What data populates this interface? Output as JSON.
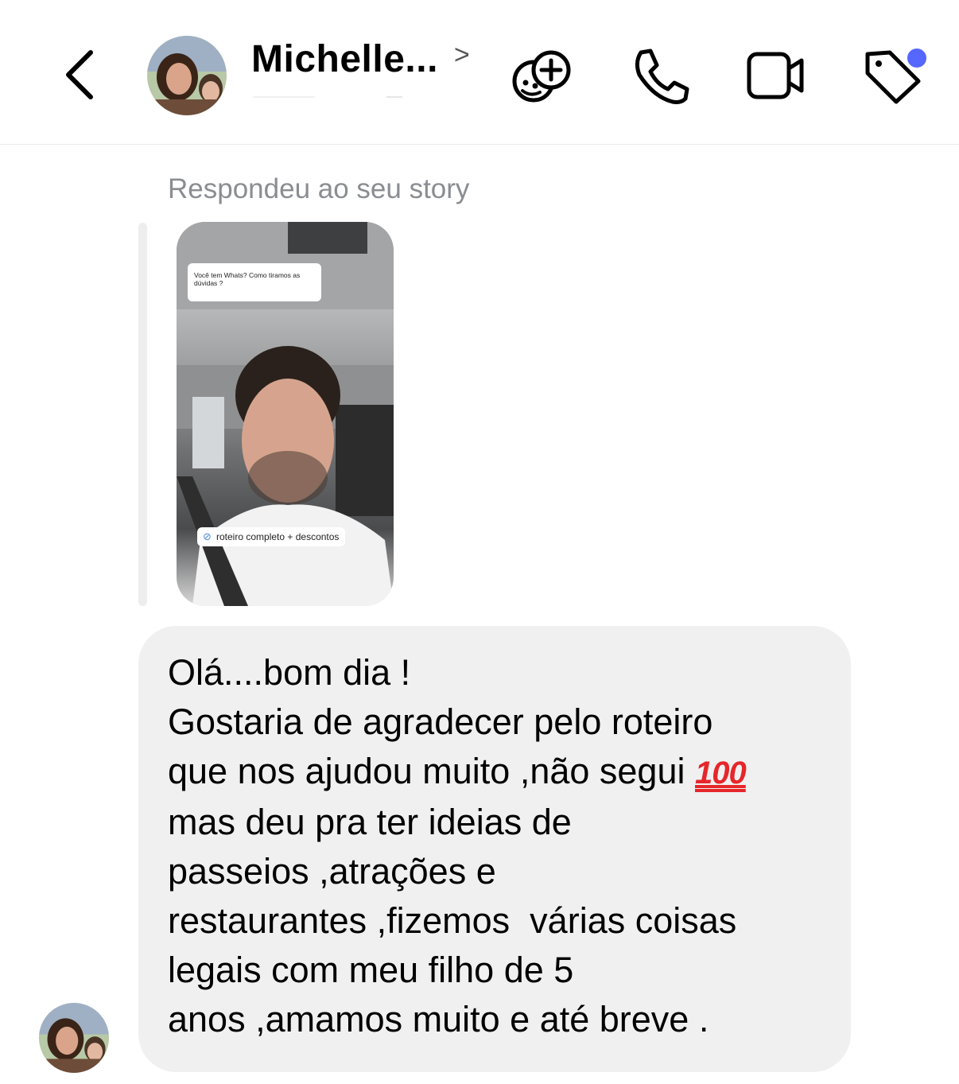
{
  "header": {
    "back_icon": "chevron-left-icon",
    "contact_name": "Michelle...",
    "name_chevron": ">",
    "icons": [
      "game-controller-add-icon",
      "phone-icon",
      "video-camera-icon",
      "tag-icon"
    ],
    "notification_dot_color": "#5567ff"
  },
  "conversation": {
    "story_reply_label": "Respondeu ao seu story",
    "story": {
      "question_text": "Você tem Whats? Como tiramos as dúvidas ?",
      "link_sticker_text": "roteiro completo + descontos",
      "link_icon": "link-icon"
    },
    "message": {
      "lines": [
        "Olá....bom dia !",
        "Gostaria de agradecer pelo roteiro",
        "que nos ajudou muito ,não segui",
        "mas deu pra ter ideias de",
        "passeios ,atrações e",
        "restaurantes ,fizemos  várias coisas",
        "legais com meu filho de 5",
        "anos ,amamos muito e até breve ."
      ],
      "emoji": "100",
      "bubble_color": "#f0f0f1"
    }
  }
}
